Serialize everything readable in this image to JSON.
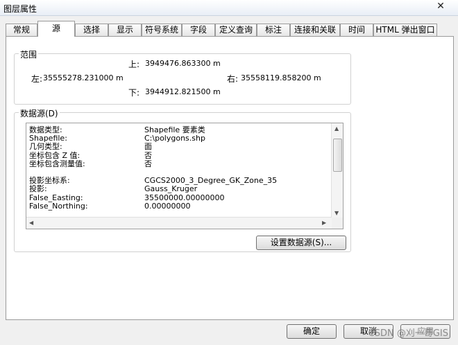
{
  "window": {
    "title": "图层属性",
    "close_glyph": "✕"
  },
  "tabs": [
    {
      "label": "常规"
    },
    {
      "label": "源"
    },
    {
      "label": "选择"
    },
    {
      "label": "显示"
    },
    {
      "label": "符号系统"
    },
    {
      "label": "字段"
    },
    {
      "label": "定义查询"
    },
    {
      "label": "标注"
    },
    {
      "label": "连接和关联"
    },
    {
      "label": "时间"
    },
    {
      "label": "HTML 弹出窗口"
    }
  ],
  "extent": {
    "group_label": "范围",
    "top_label": "上:",
    "top_value": "3949476.863300 m",
    "left_label": "左:",
    "left_value": "35555278.231000 m",
    "right_label": "右:",
    "right_value": "35558119.858200 m",
    "bottom_label": "下:",
    "bottom_value": "3944912.821500 m"
  },
  "datasource": {
    "group_label": "数据源(D)",
    "rows": [
      {
        "k": "数据类型:",
        "v": "Shapefile 要素类"
      },
      {
        "k": "Shapefile:",
        "v": "C:\\polygons.shp"
      },
      {
        "k": "几何类型:",
        "v": "面"
      },
      {
        "k": "坐标包含 Z 值:",
        "v": "否"
      },
      {
        "k": "坐标包含测量值:",
        "v": "否"
      },
      {
        "k": "",
        "v": ""
      },
      {
        "k": "投影坐标系:",
        "v": "CGCS2000_3_Degree_GK_Zone_35"
      },
      {
        "k": "投影:",
        "v": "Gauss_Kruger"
      },
      {
        "k": "False_Easting:",
        "v": "35500000.00000000"
      },
      {
        "k": "False_Northing:",
        "v": "0.00000000"
      }
    ],
    "set_button": "设置数据源(S)..."
  },
  "footer": {
    "ok": "确定",
    "cancel": "取消",
    "apply": "应用"
  },
  "watermark": "CSDN @刈一哥GIS"
}
